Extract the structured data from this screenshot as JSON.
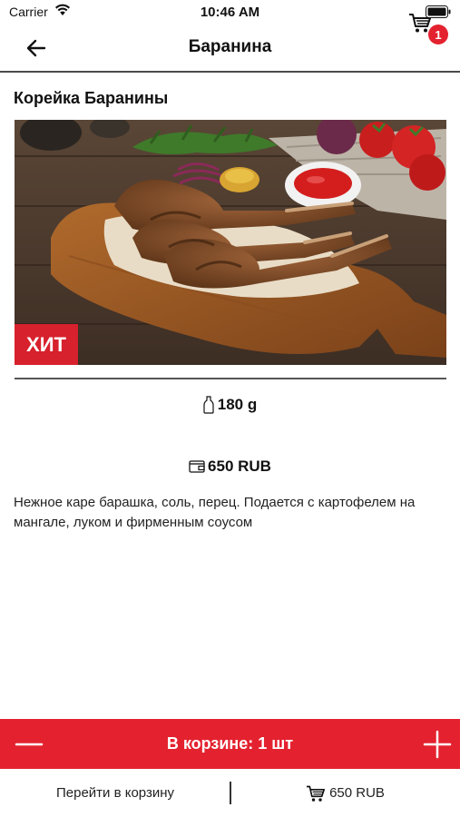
{
  "status_bar": {
    "carrier": "Carrier",
    "time": "10:46 AM"
  },
  "nav": {
    "title": "Баранина",
    "cart_count": "1"
  },
  "product": {
    "title": "Корейка Баранины",
    "badge": "ХИТ",
    "weight": "180 g",
    "price": "650 RUB",
    "description": "Нежное каре барашка, соль, перец. Подается с картофелем на мангале, луком и фирменным соусом"
  },
  "cart_bar": {
    "label": "В корзине: 1 шт"
  },
  "footer": {
    "go_to_cart": "Перейти в корзину",
    "total": "650 RUB"
  },
  "colors": {
    "accent": "#e4222f",
    "badge": "#d7212d"
  }
}
